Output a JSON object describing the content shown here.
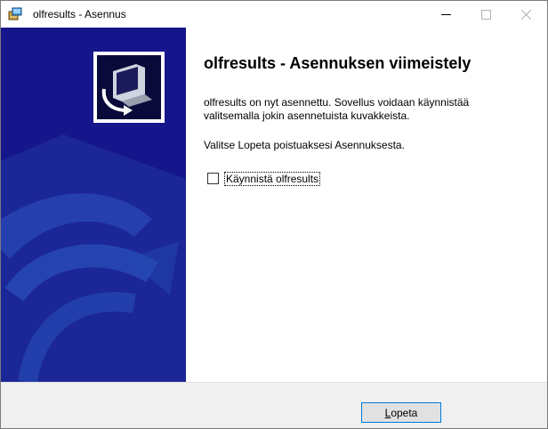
{
  "window": {
    "title": "olfresults - Asennus",
    "controls": [
      "minimize-icon",
      "maximize-icon",
      "close-icon"
    ]
  },
  "sidepanel": {
    "logo_icon": "computer-install-icon",
    "background_color": "#16168c"
  },
  "content": {
    "heading": "olfresults - Asennuksen viimeistely",
    "paragraph1_line1": "olfresults on nyt asennettu. Sovellus voidaan käynnistää",
    "paragraph1_line2": "valitsemalla jokin asennetuista kuvakkeista.",
    "paragraph2": "Valitse Lopeta poistuaksesi Asennuksesta.",
    "launch_checkbox": {
      "label": "Käynnistä olfresults",
      "checked": false
    }
  },
  "footer": {
    "finish_button": {
      "label_first": "L",
      "label_rest": "opeta"
    }
  },
  "colors": {
    "accent": "#0078d7",
    "footer_bg": "#f0f0f0"
  }
}
